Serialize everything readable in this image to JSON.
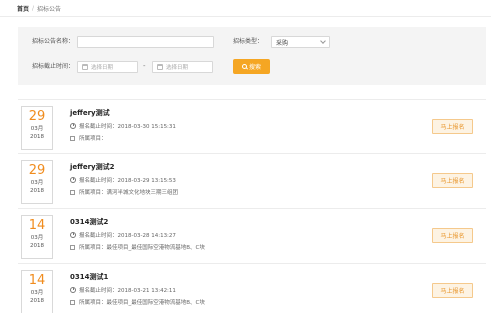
{
  "breadcrumb": {
    "home": "首页",
    "separator": "/",
    "current": "招标公告"
  },
  "search": {
    "name_label": "招标公告名称：",
    "name_value": "",
    "type_label": "招标类型：",
    "type_value": "采购",
    "deadline_label": "招标截止时间：",
    "start_placeholder": "选择日期",
    "end_placeholder": "选择日期",
    "range_sep": "-",
    "button_label": "搜索"
  },
  "items": [
    {
      "day": "29",
      "month": "03月",
      "year": "2018",
      "title": "jeffery测试",
      "deadline": "报名截止时间：2018-03-30 15:15:31",
      "project": "所属项目：",
      "apply": "马上报名"
    },
    {
      "day": "29",
      "month": "03月",
      "year": "2018",
      "title": "jeffery测试2",
      "deadline": "报名截止时间：2018-03-29 13:15:53",
      "project": "所属项目：满河半城文化地块三期三组团",
      "apply": "马上报名"
    },
    {
      "day": "14",
      "month": "03月",
      "year": "2018",
      "title": "0314测试2",
      "deadline": "报名截止时间：2018-03-28 14:13:27",
      "project": "所属项目：最佳项目_最佳国际空港物流基地B、C块",
      "apply": "马上报名"
    },
    {
      "day": "14",
      "month": "03月",
      "year": "2018",
      "title": "0314测试1",
      "deadline": "报名截止时间：2018-03-21 13:42:11",
      "project": "所属项目：最佳项目_最佳国际空港物流基地B、C块",
      "apply": "马上报名"
    }
  ],
  "colors": {
    "accent": "#f5a623",
    "date_number": "#f08c1e",
    "panel_bg": "#f4f4f4"
  },
  "icons": {
    "date": "calendar-icon",
    "deadline": "clock-icon",
    "project": "folder-icon",
    "search": "search-icon",
    "dropdown": "chevron-down-icon"
  }
}
